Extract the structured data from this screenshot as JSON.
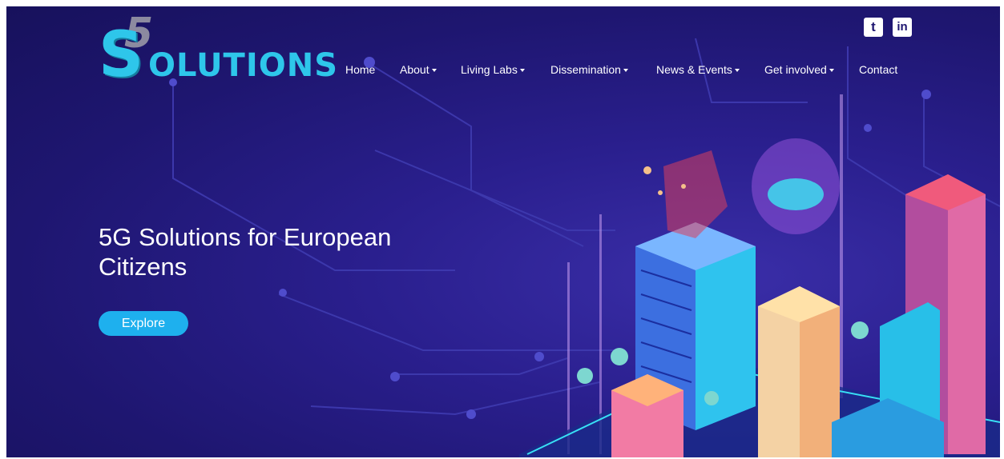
{
  "brand": {
    "logo_prefix": "5",
    "logo_letter": "S",
    "logo_rest": "OLUTIONS"
  },
  "social": [
    {
      "icon": "twitter-icon",
      "glyph": "t"
    },
    {
      "icon": "linkedin-icon",
      "glyph": "in"
    }
  ],
  "nav": {
    "home": "Home",
    "about": "About",
    "living_labs": "Living Labs",
    "dissemination": "Dissemination",
    "news_events": "News & Events",
    "get_involved": "Get involved",
    "contact": "Contact"
  },
  "hero": {
    "title": "5G Solutions for European Citizens",
    "cta": "Explore"
  },
  "colors": {
    "background": "#1e1670",
    "accent": "#1eb0ee",
    "logo": "#2ec6ea"
  }
}
